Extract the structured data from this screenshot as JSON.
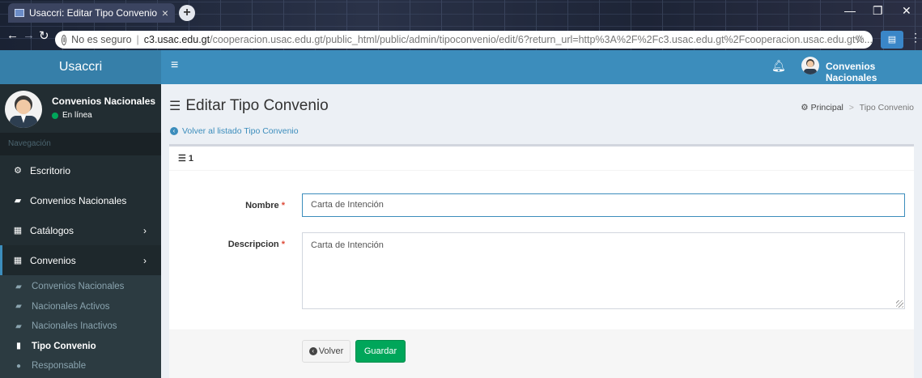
{
  "browser": {
    "tab_title": "Usaccri: Editar Tipo Convenio",
    "tab_close": "×",
    "new_tab": "+",
    "security_text": "No es seguro",
    "url_host": "c3.usac.edu.gt",
    "url_path": "/cooperacion.usac.edu.gt/public_html/public/admin/tipoconvenio/edit/6?return_url=http%3A%2F%2Fc3.usac.edu.gt%2Fcooperacion.usac.edu.gt%..."
  },
  "topbar": {
    "logo": "Usaccri",
    "user_name": "Convenios Nacionales"
  },
  "sidebar": {
    "user": {
      "name": "Convenios Nacionales",
      "status": "En línea"
    },
    "header": "Navegación",
    "items": [
      {
        "label": "Escritorio"
      },
      {
        "label": "Convenios Nacionales"
      },
      {
        "label": "Catálogos"
      },
      {
        "label": "Convenios"
      }
    ],
    "subitems": [
      {
        "label": "Convenios Nacionales"
      },
      {
        "label": "Nacionales Activos"
      },
      {
        "label": "Nacionales Inactivos"
      },
      {
        "label": "Tipo Convenio"
      },
      {
        "label": "Responsable"
      }
    ]
  },
  "page": {
    "title": "Editar Tipo Convenio",
    "breadcrumb_home": "Principal",
    "breadcrumb_current": "Tipo Convenio",
    "back_link": "Volver al listado Tipo Convenio",
    "box_title": "1"
  },
  "form": {
    "nombre_label": "Nombre",
    "descripcion_label": "Descripcion",
    "required_mark": "*",
    "nombre_value": "Carta de Intención",
    "descripcion_value": "Carta de Intención",
    "back_button": "Volver",
    "save_button": "Guardar"
  }
}
